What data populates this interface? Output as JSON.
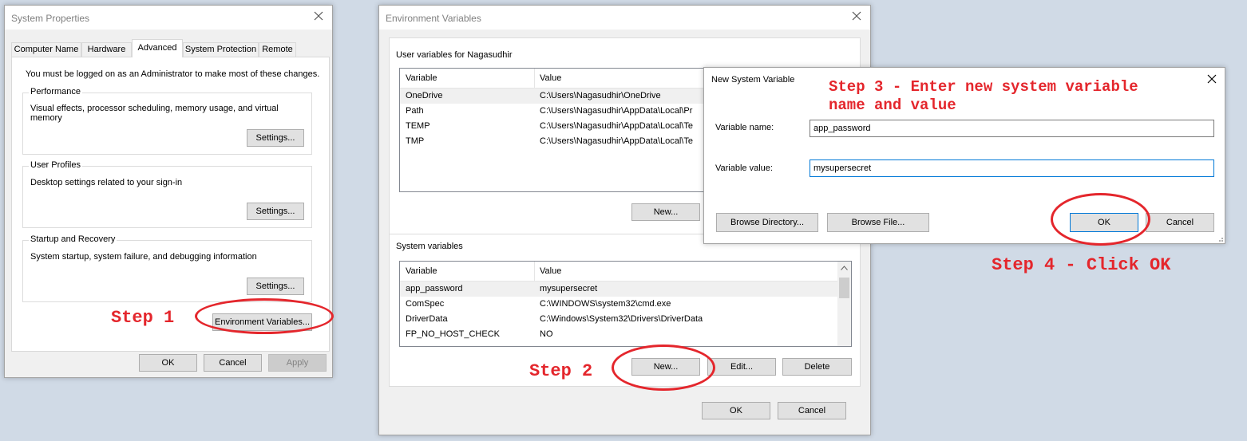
{
  "system_properties": {
    "title": "System Properties",
    "tabs": [
      "Computer Name",
      "Hardware",
      "Advanced",
      "System Protection",
      "Remote"
    ],
    "active_tab": "Advanced",
    "admin_note": "You must be logged on as an Administrator to make most of these changes.",
    "performance": {
      "label": "Performance",
      "desc": "Visual effects, processor scheduling, memory usage, and virtual memory",
      "button": "Settings..."
    },
    "user_profiles": {
      "label": "User Profiles",
      "desc": "Desktop settings related to your sign-in",
      "button": "Settings..."
    },
    "startup": {
      "label": "Startup and Recovery",
      "desc": "System startup, system failure, and debugging information",
      "button": "Settings..."
    },
    "env_button": "Environment Variables...",
    "ok": "OK",
    "cancel": "Cancel",
    "apply": "Apply"
  },
  "env_vars": {
    "title": "Environment Variables",
    "user_group": "User variables for Nagasudhir",
    "col_variable": "Variable",
    "col_value": "Value",
    "user_rows": [
      {
        "name": "OneDrive",
        "value": "C:\\Users\\Nagasudhir\\OneDrive"
      },
      {
        "name": "Path",
        "value": "C:\\Users\\Nagasudhir\\AppData\\Local\\Pr"
      },
      {
        "name": "TEMP",
        "value": "C:\\Users\\Nagasudhir\\AppData\\Local\\Te"
      },
      {
        "name": "TMP",
        "value": "C:\\Users\\Nagasudhir\\AppData\\Local\\Te"
      }
    ],
    "user_new": "New...",
    "system_group": "System variables",
    "system_rows": [
      {
        "name": "app_password",
        "value": "mysupersecret"
      },
      {
        "name": "ComSpec",
        "value": "C:\\WINDOWS\\system32\\cmd.exe"
      },
      {
        "name": "DriverData",
        "value": "C:\\Windows\\System32\\Drivers\\DriverData"
      },
      {
        "name": "FP_NO_HOST_CHECK",
        "value": "NO"
      }
    ],
    "sys_new": "New...",
    "sys_edit": "Edit...",
    "sys_delete": "Delete",
    "ok": "OK",
    "cancel": "Cancel"
  },
  "new_var": {
    "title": "New System Variable",
    "name_label": "Variable name:",
    "name_value": "app_password",
    "value_label": "Variable value:",
    "value_value": "mysupersecret",
    "browse_dir": "Browse Directory...",
    "browse_file": "Browse File...",
    "ok": "OK",
    "cancel": "Cancel"
  },
  "annotations": {
    "step1": "Step 1",
    "step2": "Step 2",
    "step3": "Step 3 - Enter new system variable\nname and value",
    "step4": "Step 4 - Click OK",
    "color": "#e4262c"
  }
}
